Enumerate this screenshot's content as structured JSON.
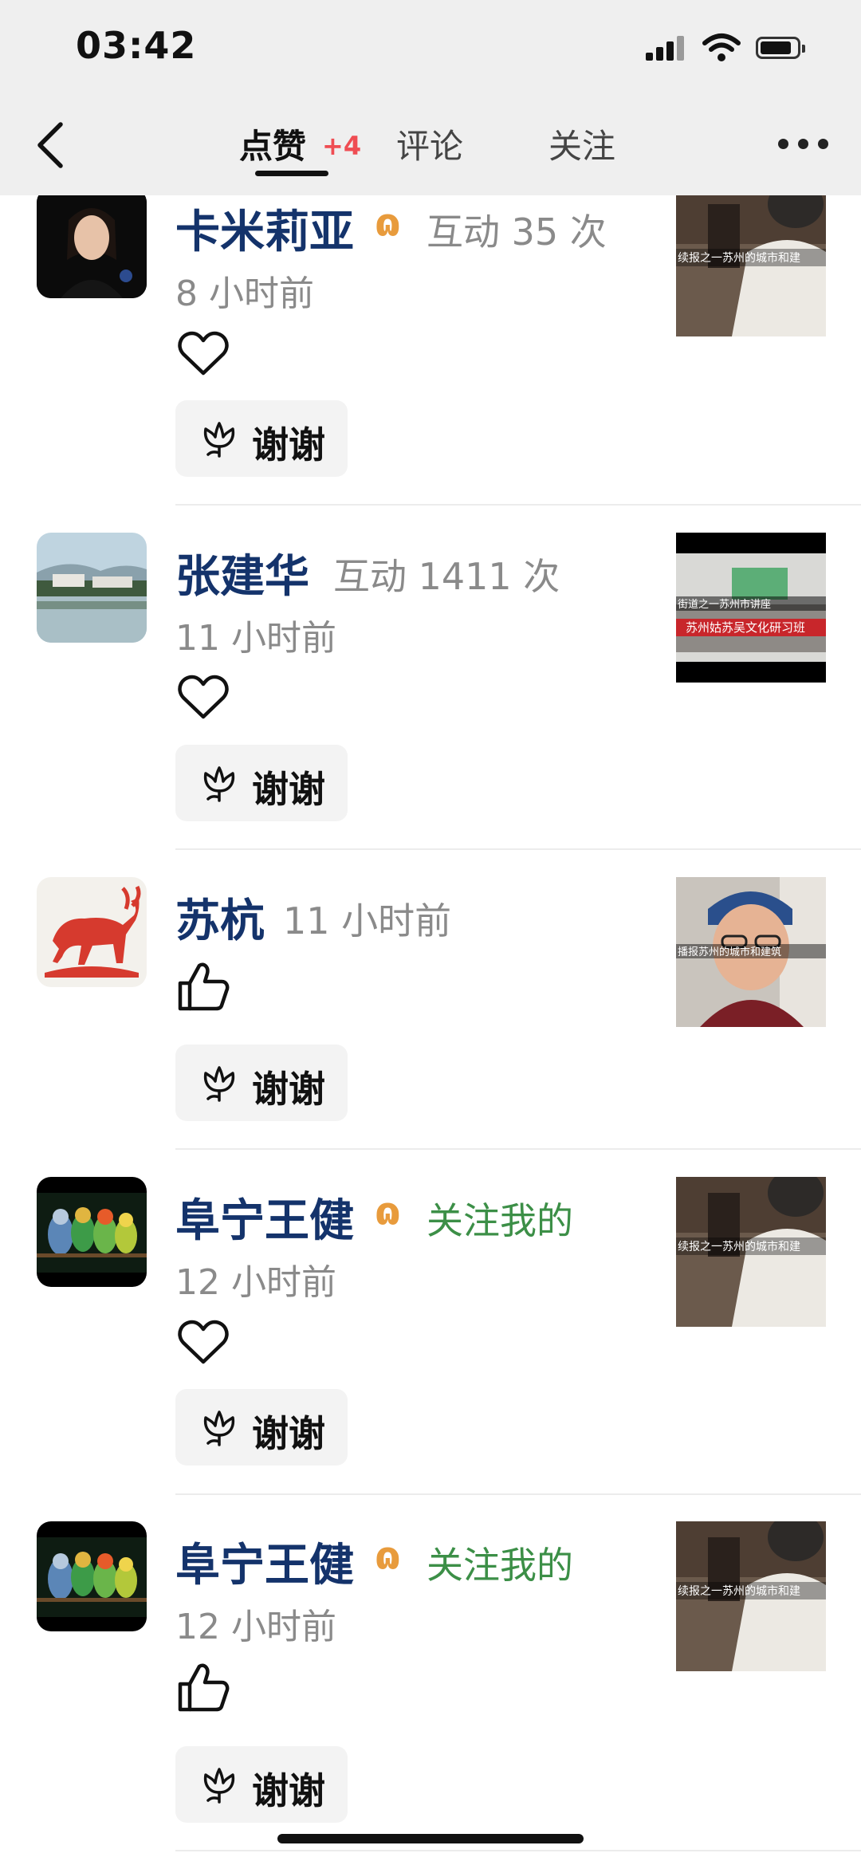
{
  "status_bar": {
    "time": "03:42"
  },
  "header": {
    "tabs": [
      {
        "label": "点赞",
        "badge": "+4",
        "active": true
      },
      {
        "label": "评论",
        "active": false
      },
      {
        "label": "关注",
        "active": false
      }
    ]
  },
  "items": [
    {
      "name": "卡米莉亚",
      "vip": true,
      "meta": "互动 35 次",
      "meta_style": "gray",
      "time": "8 小时前",
      "reaction": "heart",
      "thanks_label": "谢谢"
    },
    {
      "name": "张建华",
      "vip": false,
      "meta": "互动 1411 次",
      "meta_style": "gray",
      "time": "11 小时前",
      "reaction": "heart",
      "thanks_label": "谢谢"
    },
    {
      "name": "苏杭",
      "vip": false,
      "meta": "11 小时前",
      "meta_style": "gray",
      "time": "",
      "reaction": "thumbs-up",
      "thanks_label": "谢谢"
    },
    {
      "name": "阜宁王健",
      "vip": true,
      "meta": "关注我的",
      "meta_style": "green",
      "time": "12 小时前",
      "reaction": "heart",
      "thanks_label": "谢谢"
    },
    {
      "name": "阜宁王健",
      "vip": true,
      "meta": "关注我的",
      "meta_style": "green",
      "time": "12 小时前",
      "reaction": "thumbs-up",
      "thanks_label": "谢谢"
    }
  ],
  "colors": {
    "name": "#14336b",
    "badge": "#ef4d53",
    "follow": "#3c8f47",
    "vip": "#e89b3c"
  }
}
